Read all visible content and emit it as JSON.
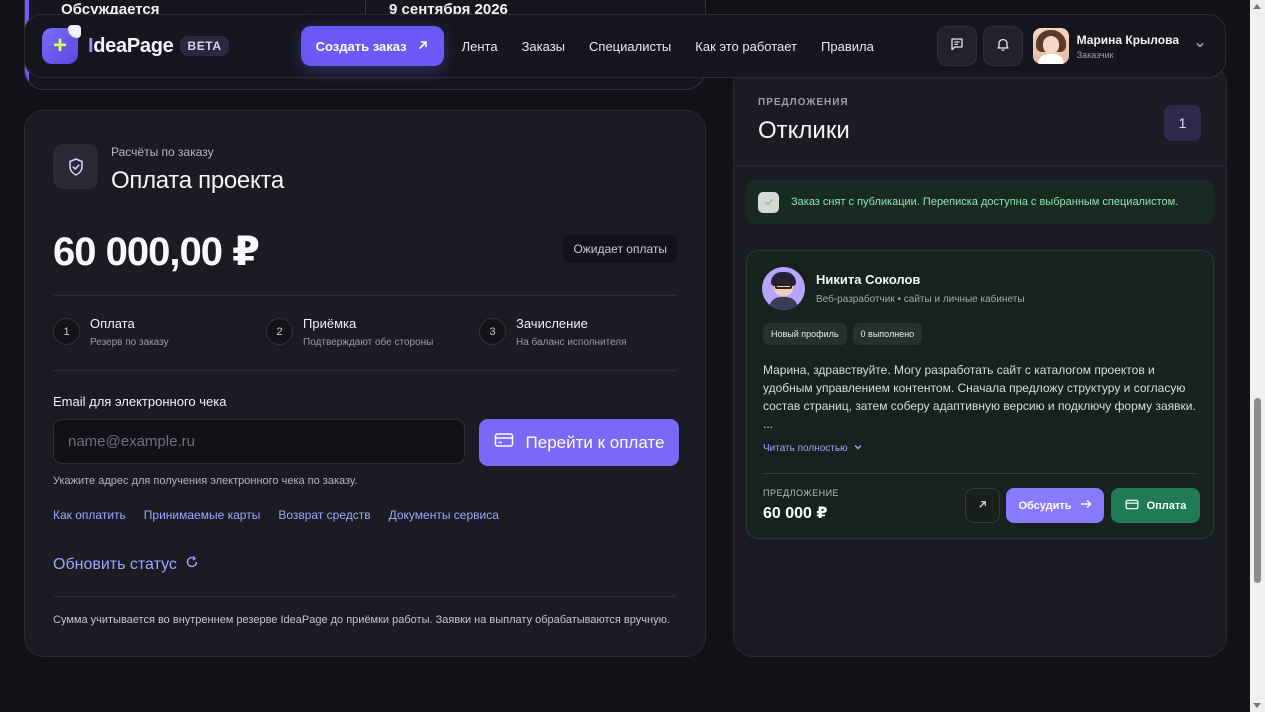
{
  "top_card": {
    "left_value": "Обсуждается",
    "right_value": "9 сентября 2026"
  },
  "nav": {
    "brand_first": "I",
    "brand_rest": "deaPage",
    "beta": "BETA",
    "create_order": "Создать заказ",
    "create_order_icon": "arrow-up-right-icon",
    "links": [
      "Лента",
      "Заказы",
      "Специалисты",
      "Как это работает",
      "Правила"
    ],
    "user_name": "Марина Крылова",
    "user_role": "Заказчик"
  },
  "payment": {
    "subtitle": "Расчёты по заказу",
    "title": "Оплата проекта",
    "amount": "60 000,00 ₽",
    "status": "Ожидает оплаты",
    "steps": [
      {
        "num": "1",
        "title": "Оплата",
        "desc": "Резерв по заказу"
      },
      {
        "num": "2",
        "title": "Приёмка",
        "desc": "Подтверждают обе стороны"
      },
      {
        "num": "3",
        "title": "Зачисление",
        "desc": "На баланс исполнителя"
      }
    ],
    "email_label": "Email для электронного чека",
    "email_placeholder": "name@example.ru",
    "email_value": "",
    "pay_button": "Перейти к оплате",
    "email_hint": "Укажите адрес для получения электронного чека по заказу.",
    "links": [
      "Как оплатить",
      "Принимаемые карты",
      "Возврат средств",
      "Документы сервиса"
    ],
    "refresh": "Обновить статус",
    "note": "Сумма учитывается во внутреннем резерве IdeaPage до приёмки работы. Заявки на выплату обрабатываются вручную."
  },
  "proposals": {
    "overline": "ПРЕДЛОЖЕНИЯ",
    "title": "Отклики",
    "count": "1",
    "notice": "Заказ снят с публикации. Переписка доступна с выбранным специалистом.",
    "offer": {
      "name": "Никита Соколов",
      "role": "Веб-разработчик • сайты и личные кабинеты",
      "chips": [
        "Новый профиль",
        "0 выполнено"
      ],
      "text": "Марина, здравствуйте. Могу разработать сайт с каталогом проектов и удобным управлением контентом. Сначала предложу структуру и согласую состав страниц, затем соберу адаптивную версию и подключу форму заявки. ...",
      "read_more": "Читать полностью",
      "price_label": "ПРЕДЛОЖЕНИЕ",
      "price": "60 000 ₽",
      "discuss": "Обсудить",
      "pay": "Оплата"
    }
  },
  "colors": {
    "accent": "#6b58f5",
    "accent_light": "#a8a0ff",
    "success": "#1f7a55",
    "background": "#121218",
    "card": "#1b1b23"
  }
}
